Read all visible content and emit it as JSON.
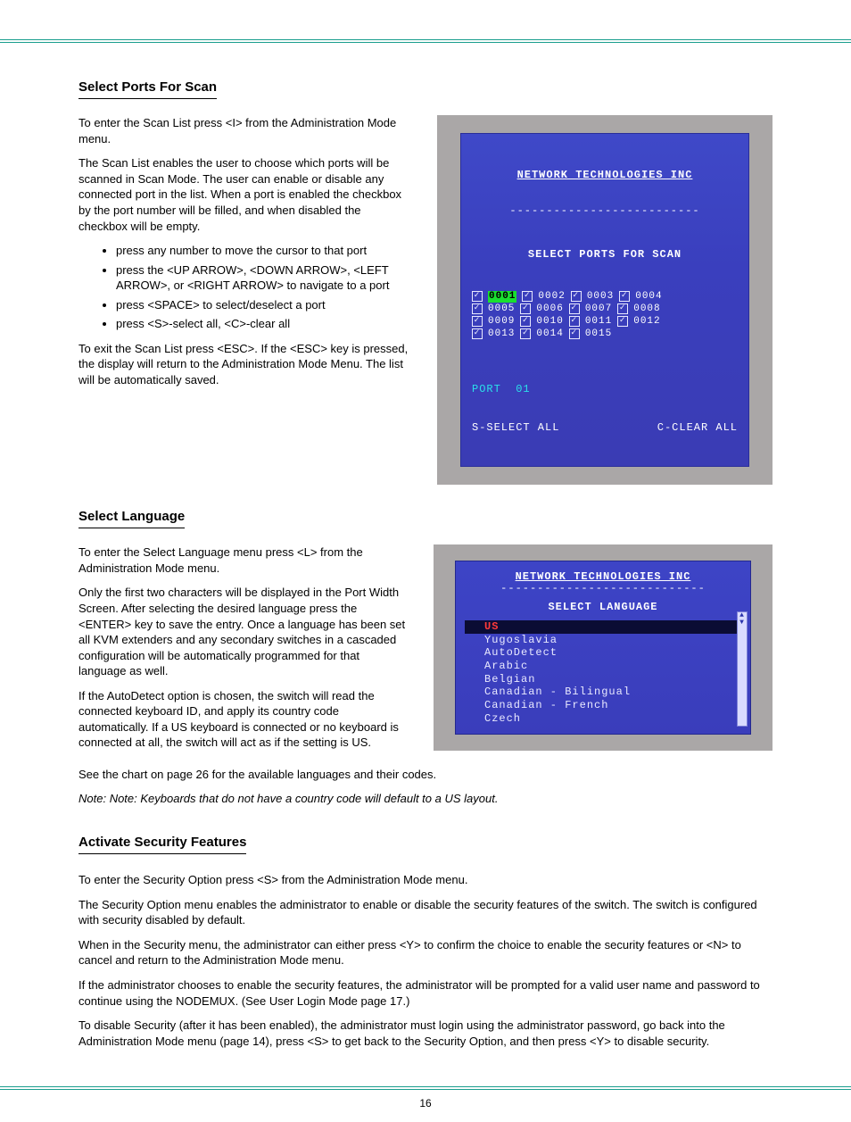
{
  "page_number": "16",
  "sections": {
    "scan_list": {
      "heading": "Select Ports For Scan",
      "intro_para": "To enter the Scan List press <I> from the Administration Mode menu.",
      "desc_para": "The Scan List enables the user to choose which ports will be scanned in Scan Mode. The user can enable or disable any connected port in the list. When a port is enabled the checkbox by the port number will be filled, and when disabled the checkbox will be empty.",
      "bullet_1": "press any number to move the cursor to that port",
      "bullet_2": "press the <UP ARROW>, <DOWN ARROW>, <LEFT ARROW>, or <RIGHT ARROW> to navigate to a port",
      "bullet_3": "press <SPACE> to select/deselect a port",
      "bullet_4": "press <S>-select all, <C>-clear all",
      "exit_para": "To exit the Scan List press <ESC>. If the <ESC> key is pressed, the display will return to the Administration Mode Menu. The list will be automatically saved."
    },
    "select_lang": {
      "heading": "Select Language",
      "intro_para": "To enter the Select Language menu press <L> from the Administration Mode menu.",
      "desc_para": "Only the first two characters will be displayed in the Port Width Screen. After selecting the desired language press the <ENTER> key to save the entry. Once a language has been set all KVM extenders and any secondary switches in a cascaded configuration will be automatically programmed for that language as well.",
      "para3": "If the AutoDetect option is chosen, the switch will read the connected keyboard ID, and apply its country code automatically. If a US keyboard is connected or no keyboard is connected at all, the switch will act as if the setting is US.",
      "para4": "See the chart on page 26 for the available languages and their codes.",
      "note": "Note: Keyboards that do not have a country code will default to a US layout."
    },
    "activate_security": {
      "heading": "Activate Security Features",
      "para1": "To enter the Security Option press <S> from the Administration Mode menu.",
      "para2": "The Security Option menu enables the administrator to enable or disable the security features of the switch. The switch is configured with security disabled by default.",
      "para3": "When in the Security menu, the administrator can either press <Y> to confirm the choice to enable the security features or <N> to cancel and return to the Administration Mode menu.",
      "para4": "If the administrator chooses to enable the security features, the administrator will be prompted for a valid user name and password to continue using the NODEMUX. (See User Login Mode page 17.)",
      "para5": "To disable Security (after it has been enabled), the administrator must login using the administrator password, go back into the Administration Mode menu (page 14), press <S> to get back to the Security Option, and then press <Y> to disable security."
    }
  },
  "screenshot1": {
    "company": "NETWORK TECHNOLOGIES INC",
    "title": "SELECT PORTS FOR SCAN",
    "ports": [
      "0001",
      "0002",
      "0003",
      "0004",
      "0005",
      "0006",
      "0007",
      "0008",
      "0009",
      "0010",
      "0011",
      "0012",
      "0013",
      "0014",
      "0015"
    ],
    "selected_port": "0001",
    "port_line": "PORT  01",
    "hint_left": "S-SELECT ALL",
    "hint_right": "C-CLEAR ALL"
  },
  "screenshot2": {
    "company": "NETWORK TECHNOLOGIES INC",
    "title": "SELECT LANGUAGE",
    "selected": "US",
    "languages": [
      "Yugoslavia",
      "AutoDetect",
      "Arabic",
      "Belgian",
      "Canadian - Bilingual",
      "Canadian - French",
      "Czech"
    ]
  }
}
